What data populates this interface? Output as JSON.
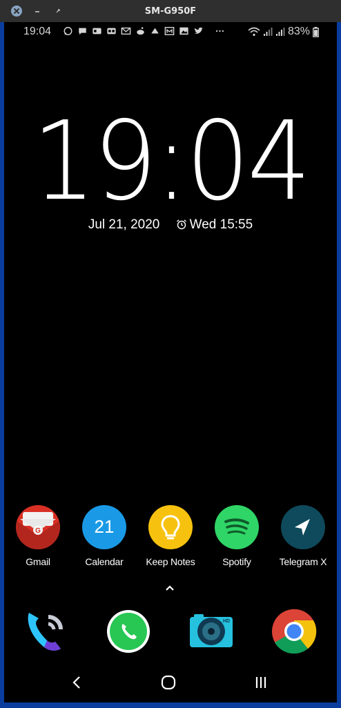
{
  "window": {
    "title": "SM-G950F"
  },
  "status": {
    "time": "19:04",
    "battery": "83%"
  },
  "lockscreen": {
    "clock": "19:04",
    "date": "Jul 21, 2020",
    "alarm": "Wed 15:55"
  },
  "apps": [
    {
      "label": "Gmail",
      "color": "#d93025"
    },
    {
      "label": "Calendar",
      "color": "#1a9ae6",
      "day": "21"
    },
    {
      "label": "Keep Notes",
      "color": "#f7c20f"
    },
    {
      "label": "Spotify",
      "color": "#2fd566"
    },
    {
      "label": "Telegram X",
      "color": "#0e4a5c"
    }
  ],
  "dock": [
    "phone-icon",
    "whatsapp-icon",
    "camera-icon",
    "chrome-icon"
  ],
  "navbar": [
    "back-icon",
    "home-icon",
    "recents-icon"
  ]
}
